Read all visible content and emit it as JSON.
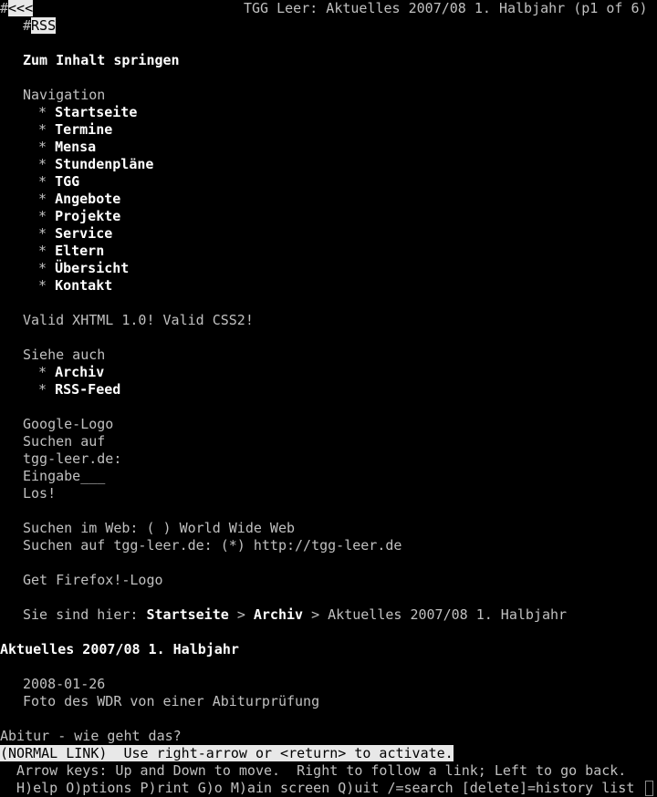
{
  "terminal": {
    "app": "Lynx text web browser",
    "cols": 86,
    "rows": 46,
    "char_width": 8.35,
    "line_height": 19,
    "colors": {
      "background": "#000000",
      "normal_text": "#c0c0c0",
      "bold_link_text": "#ffffff",
      "reverse_bg": "#e8e8e8",
      "reverse_fg": "#000000",
      "cursor_border": "#8a8a8a"
    }
  },
  "header": {
    "toolbar_hash": "#",
    "back_link": "<<<",
    "rss_hash": "#",
    "rss_link": "RSS",
    "title": "TGG Leer: Aktuelles 2007/08 1. Halbjahr (p1 of 6)"
  },
  "page": {
    "skip_link": "Zum Inhalt springen",
    "nav_heading": "Navigation",
    "nav_items": [
      "Startseite",
      "Termine",
      "Mensa",
      "Stundenpläne",
      "TGG",
      "Angebote",
      "Projekte",
      "Service",
      "Eltern",
      "Übersicht",
      "Kontakt"
    ],
    "bullet": "*",
    "validation_line": "Valid XHTML 1.0! Valid CSS2!",
    "see_also_heading": "Siehe auch",
    "see_also_items": [
      "Archiv",
      "RSS-Feed"
    ],
    "search_block": [
      "Google-Logo",
      "Suchen auf",
      "tgg-leer.de:",
      "Eingabe___",
      "Los!"
    ],
    "radio_web_label": "Suchen im Web:",
    "radio_web_state": "( )",
    "radio_web_value": "World Wide Web",
    "radio_site_label": "Suchen auf tgg-leer.de:",
    "radio_site_state": "(*)",
    "radio_site_value": "http://tgg-leer.de",
    "firefox_logo": "Get Firefox!-Logo",
    "breadcrumb_label": "Sie sind hier:",
    "breadcrumb_links": [
      "Startseite",
      "Archiv"
    ],
    "breadcrumb_separator": ">",
    "breadcrumb_current": "Aktuelles 2007/08 1. Halbjahr",
    "article_heading": "Aktuelles 2007/08 1. Halbjahr",
    "article_date": "2008-01-26",
    "article_caption": "Foto des WDR von einer Abiturprüfung",
    "article_link": "Abitur - wie geht das?"
  },
  "status": {
    "mode_line": "(NORMAL LINK)  Use right-arrow or <return> to activate.",
    "help_line_1": "  Arrow keys: Up and Down to move.  Right to follow a link; Left to go back.",
    "help_line_2": "  H)elp O)ptions P)rint G)o M)ain screen Q)uit /=search [delete]=history list"
  }
}
